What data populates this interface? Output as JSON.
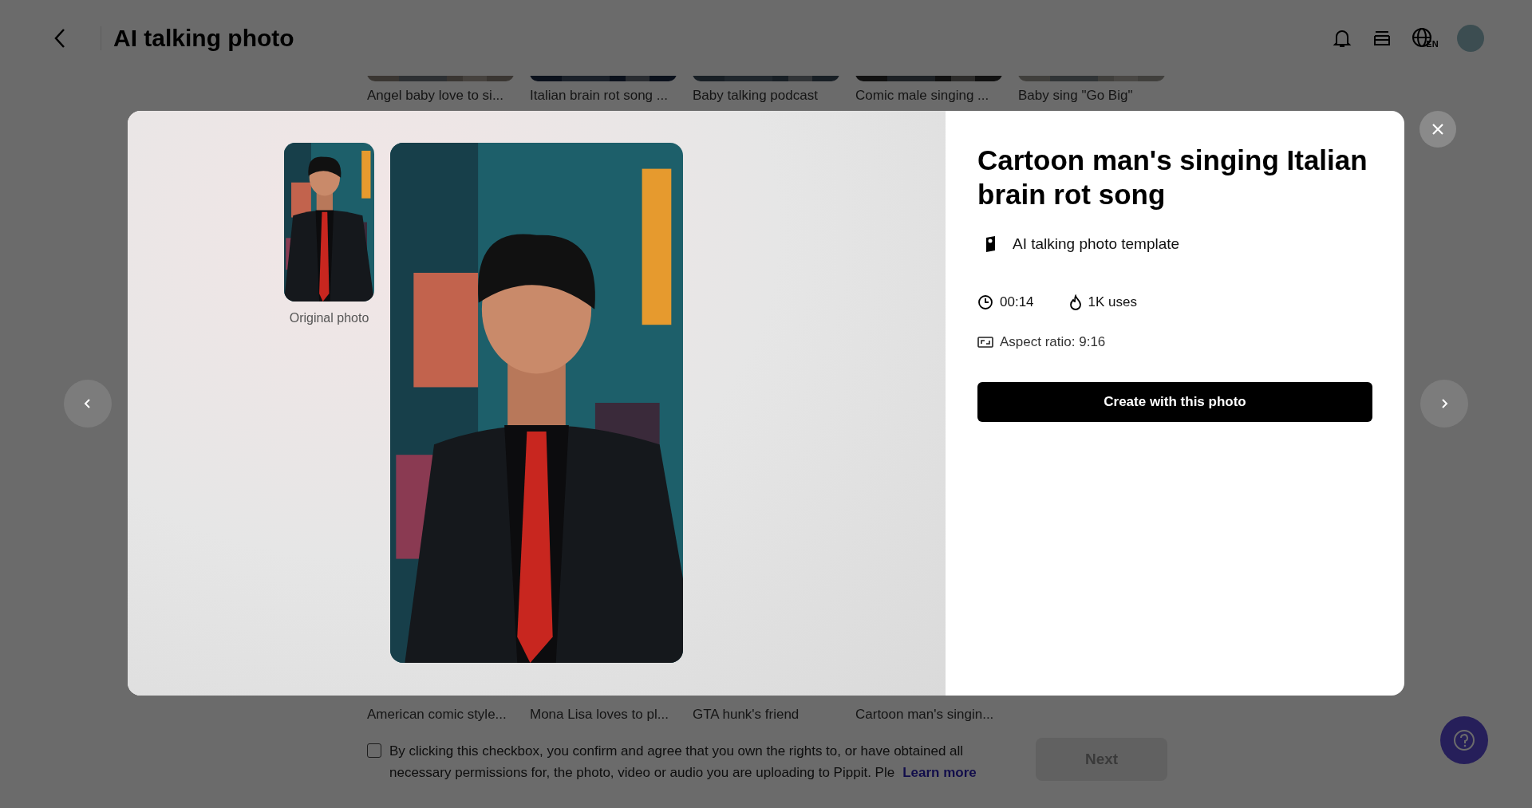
{
  "header": {
    "title": "AI talking photo",
    "language": "EN"
  },
  "templates_top": [
    {
      "label": "Angel baby love to si..."
    },
    {
      "label": "Italian brain rot song ..."
    },
    {
      "label": "Baby talking podcast"
    },
    {
      "label": "Comic male singing ..."
    },
    {
      "label": "Baby sing \"Go Big\""
    }
  ],
  "templates_bottom": [
    {
      "label": "American comic style..."
    },
    {
      "label": "Mona Lisa loves to pl..."
    },
    {
      "label": "GTA hunk's friend"
    },
    {
      "label": "Cartoon man's singin..."
    }
  ],
  "consent": {
    "checked": false,
    "text": "By clicking this checkbox, you confirm and agree that you own the rights to, or have obtained all necessary permissions for, the photo, video or audio you are uploading to Pippit. Ple",
    "link": "Learn more"
  },
  "next_button": {
    "label": "Next",
    "disabled": true
  },
  "modal": {
    "original_label": "Original photo",
    "title": "Cartoon man's singing Italian brain rot song",
    "type_label": "AI talking photo template",
    "duration": "00:14",
    "uses": "1K uses",
    "aspect": "Aspect ratio: 9:16",
    "create_button": "Create with this photo"
  }
}
